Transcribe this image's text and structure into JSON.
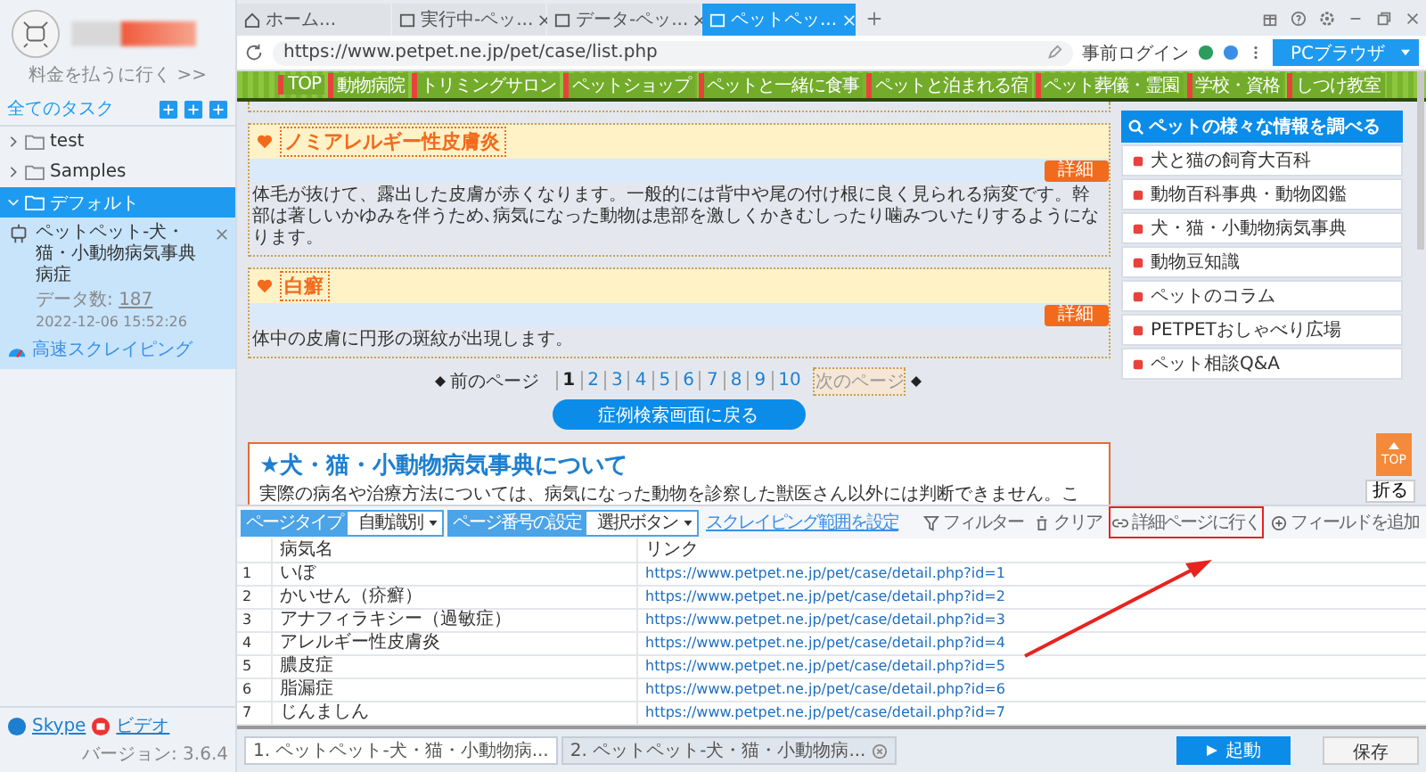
{
  "sidebar": {
    "account_link": "料金を払うに行く >>",
    "section_title": "全てのタスク",
    "folders": [
      {
        "label": "test",
        "expanded": false,
        "selected": false
      },
      {
        "label": "Samples",
        "expanded": false,
        "selected": false
      },
      {
        "label": "デフォルト",
        "expanded": true,
        "selected": true,
        "children": [
          {
            "title": "ペットペット-犬・猫・小動物病気事典病症",
            "count_label": "データ数:",
            "count": "187",
            "time": "2022-12-06 15:52:26",
            "mode": "高速スクレイピング"
          }
        ]
      }
    ],
    "footer": {
      "skype": "Skype",
      "video": "ビデオ",
      "version": "バージョン: 3.6.4"
    }
  },
  "browser": {
    "tabs": [
      {
        "label": "ホーム...",
        "kind": "home",
        "selected": false,
        "closable": false
      },
      {
        "label": "実行中-ペッ...",
        "kind": "page",
        "selected": false,
        "closable": true
      },
      {
        "label": "データ-ペッ...",
        "kind": "page",
        "selected": false,
        "closable": true
      },
      {
        "label": "ペットペッ...",
        "kind": "page",
        "selected": true,
        "closable": true
      }
    ],
    "url": "https://www.petpet.ne.jp/pet/case/list.php",
    "login": "事前ログイン",
    "mode_button": "PCブラウザ"
  },
  "page": {
    "nav": [
      "TOP",
      "動物病院",
      "トリミングサロン",
      "ペットショップ",
      "ペットと一緒に食事",
      "ペットと泊まれる宿",
      "ペット葬儀・霊園",
      "学校・資格",
      "しつけ教室"
    ],
    "cards": [
      {
        "title": "ノミアレルギー性皮膚炎",
        "detail": "詳細",
        "text": "体毛が抜けて、露出した皮膚が赤くなります。一般的には背中や尾の付け根に良く見られる病変です。幹部は著しいかゆみを伴うため､病気になった動物は患部を激しくかきむしったり噛みついたりするようになります。"
      },
      {
        "title": "白癬",
        "detail": "詳細",
        "text": "体中の皮膚に円形の斑紋が出現します。"
      }
    ],
    "pagination": {
      "prev": "前のページ",
      "pages": [
        {
          "label": "1",
          "selected": true
        },
        {
          "label": "2",
          "selected": false
        },
        {
          "label": "3",
          "selected": false
        },
        {
          "label": "4",
          "selected": false
        },
        {
          "label": "5",
          "selected": false
        },
        {
          "label": "6",
          "selected": false
        },
        {
          "label": "7",
          "selected": false
        },
        {
          "label": "8",
          "selected": false
        },
        {
          "label": "9",
          "selected": false
        },
        {
          "label": "10",
          "selected": false
        }
      ],
      "next": "次のページ"
    },
    "back_button": "症例検索画面に戻る",
    "about": {
      "title": "★犬・猫・小動物病気事典について",
      "text": "実際の病名や治療方法については、病気になった動物を診察した獣医さん以外には判断できません。こ"
    },
    "side_menu": {
      "title": "ペットの様々な情報を調べる",
      "items": [
        "犬と猫の飼育大百科",
        "動物百科事典・動物図鑑",
        "犬・猫・小動物病気事典",
        "動物豆知識",
        "ペットのコラム",
        "PETPETおしゃべり広場",
        "ペット相談Q&A"
      ]
    },
    "top_button": "TOP",
    "fold_button": "折る"
  },
  "panel": {
    "controls": [
      {
        "label": "ページタイプ",
        "value": "自動識別"
      },
      {
        "label": "ページ番号の設定",
        "value": "選択ボタン"
      }
    ],
    "range_link": "スクレイピング範囲を設定",
    "actions": [
      {
        "label": "フィルター",
        "kind": "filter",
        "highlighted": false
      },
      {
        "label": "クリア",
        "kind": "clear",
        "highlighted": false
      },
      {
        "label": "詳細ページに行く",
        "kind": "link",
        "highlighted": true
      },
      {
        "label": "フィールドを追加",
        "kind": "add",
        "highlighted": false
      }
    ],
    "table": {
      "columns": [
        "病気名",
        "リンク"
      ],
      "rows": [
        {
          "index": "1",
          "name": "いぼ",
          "link": "https://www.petpet.ne.jp/pet/case/detail.php?id=1"
        },
        {
          "index": "2",
          "name": "かいせん（疥癬）",
          "link": "https://www.petpet.ne.jp/pet/case/detail.php?id=2"
        },
        {
          "index": "3",
          "name": "アナフィラキシー（過敏症）",
          "link": "https://www.petpet.ne.jp/pet/case/detail.php?id=3"
        },
        {
          "index": "4",
          "name": "アレルギー性皮膚炎",
          "link": "https://www.petpet.ne.jp/pet/case/detail.php?id=4"
        },
        {
          "index": "5",
          "name": "膿皮症",
          "link": "https://www.petpet.ne.jp/pet/case/detail.php?id=5"
        },
        {
          "index": "6",
          "name": "脂漏症",
          "link": "https://www.petpet.ne.jp/pet/case/detail.php?id=6"
        },
        {
          "index": "7",
          "name": "じんましん",
          "link": "https://www.petpet.ne.jp/pet/case/detail.php?id=7"
        }
      ]
    },
    "tabs": [
      {
        "label": "1. ペットペット-犬・猫・小動物病...",
        "selected": true
      },
      {
        "label": "2. ペットペット-犬・猫・小動物病...",
        "selected": false
      }
    ],
    "start_button": "起動",
    "save_button": "保存"
  }
}
